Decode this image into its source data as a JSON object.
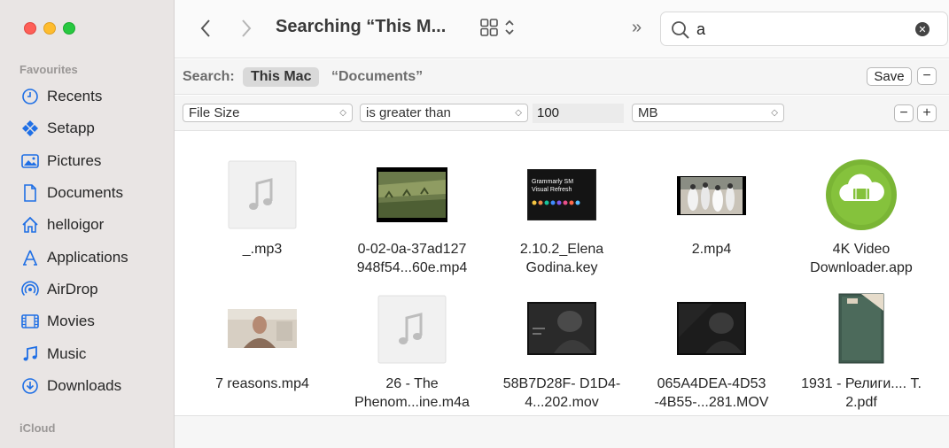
{
  "window": {
    "title": "Searching “This M..."
  },
  "sidebar": {
    "favourites_heading": "Favourites",
    "icloud_heading": "iCloud",
    "items": [
      {
        "label": "Recents",
        "icon": "clock-icon"
      },
      {
        "label": "Setapp",
        "icon": "setapp-icon"
      },
      {
        "label": "Pictures",
        "icon": "photo-icon"
      },
      {
        "label": "Documents",
        "icon": "document-icon"
      },
      {
        "label": "helloigor",
        "icon": "home-icon"
      },
      {
        "label": "Applications",
        "icon": "applications-icon"
      },
      {
        "label": "AirDrop",
        "icon": "airdrop-icon"
      },
      {
        "label": "Movies",
        "icon": "film-icon"
      },
      {
        "label": "Music",
        "icon": "music-note-icon"
      },
      {
        "label": "Downloads",
        "icon": "download-icon"
      }
    ]
  },
  "toolbar": {
    "more_label": "»",
    "search": {
      "value": "a"
    }
  },
  "scope": {
    "label": "Search:",
    "selected": "This Mac",
    "other": "“Documents”",
    "save_label": "Save",
    "remove_label": "−"
  },
  "criteria": {
    "attribute": "File Size",
    "operator": "is greater than",
    "value": "100",
    "unit": "MB",
    "remove_label": "−",
    "add_label": "+"
  },
  "files": [
    {
      "name": "_.mp3",
      "kind": "audio"
    },
    {
      "name": "0-02-0a-37ad127 948f54...60e.mp4",
      "kind": "video-field"
    },
    {
      "name": "2.10.2_Elena Godina.key",
      "kind": "keynote",
      "thumb_title": "Grammarly SM Visual Refresh"
    },
    {
      "name": "2.mp4",
      "kind": "video-people"
    },
    {
      "name": "4K Video Downloader.app",
      "kind": "app"
    },
    {
      "name": "7 reasons.mp4",
      "kind": "video-face"
    },
    {
      "name": "26 - The Phenom...ine.m4a",
      "kind": "audio"
    },
    {
      "name": "58B7D28F- D1D4-4...202.mov",
      "kind": "video-dark"
    },
    {
      "name": "065A4DEA-4D53 -4B55-...281.MOV",
      "kind": "video-dark2"
    },
    {
      "name": "1931 - Религи.... Т. 2.pdf",
      "kind": "pdf-book"
    }
  ],
  "colors": {
    "sidebar_bg": "#e9e5e4",
    "accent": "#1f6fe5",
    "traffic_red": "#fe5f57",
    "traffic_yellow": "#febc2e",
    "traffic_green": "#28c840"
  }
}
